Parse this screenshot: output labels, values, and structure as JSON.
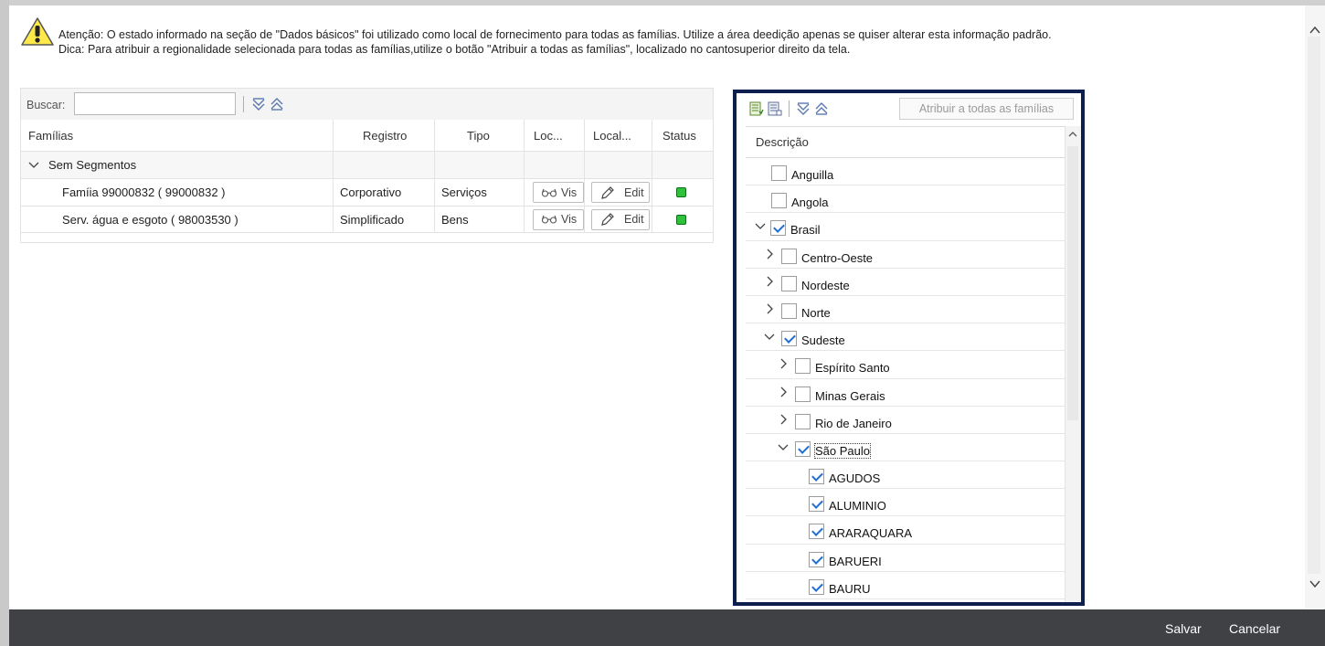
{
  "notice": {
    "line1": "Atenção: O estado informado na seção de \"Dados básicos\" foi utilizado como local de fornecimento para todas as famílias. Utilize a área deedição apenas se quiser alterar esta informação padrão.",
    "line2": "Dica: Para atribuir a regionalidade selecionada para todas as famílias,utilize o botão \"Atribuir a todas as famílias\", localizado no cantosuperior direito da tela."
  },
  "search": {
    "label": "Buscar:",
    "value": ""
  },
  "families_table": {
    "columns": [
      "Famílias",
      "Registro",
      "Tipo",
      "Loc...",
      "Local...",
      "Status"
    ],
    "group": "Sem Segmentos",
    "rows": [
      {
        "familia": "Famíia 99000832 ( 99000832 )",
        "registro": "Corporativo",
        "tipo": "Serviços",
        "view_label": "Vis",
        "edit_label": "Edit"
      },
      {
        "familia": "Serv. água e esgoto ( 98003530 )",
        "registro": "Simplificado",
        "tipo": "Bens",
        "view_label": "Vis",
        "edit_label": "Edit"
      }
    ],
    "status_color": "#2ec23a"
  },
  "region_tree": {
    "assign_button": "Atribuir a todas as famílias",
    "header": "Descrição",
    "nodes": [
      {
        "label": "Anguilla",
        "checked": false,
        "expandable": false,
        "expanded": false,
        "level": 0
      },
      {
        "label": "Angola",
        "checked": false,
        "expandable": false,
        "expanded": false,
        "level": 0
      },
      {
        "label": "Brasil",
        "checked": true,
        "expandable": true,
        "expanded": true,
        "level": 0
      },
      {
        "label": "Centro-Oeste",
        "checked": false,
        "expandable": true,
        "expanded": false,
        "level": 1
      },
      {
        "label": "Nordeste",
        "checked": false,
        "expandable": true,
        "expanded": false,
        "level": 1
      },
      {
        "label": "Norte",
        "checked": false,
        "expandable": true,
        "expanded": false,
        "level": 1
      },
      {
        "label": "Sudeste",
        "checked": true,
        "expandable": true,
        "expanded": true,
        "level": 1
      },
      {
        "label": "Espírito Santo",
        "checked": false,
        "expandable": true,
        "expanded": false,
        "level": 2
      },
      {
        "label": "Minas Gerais",
        "checked": false,
        "expandable": true,
        "expanded": false,
        "level": 2
      },
      {
        "label": "Rio de Janeiro",
        "checked": false,
        "expandable": true,
        "expanded": false,
        "level": 2
      },
      {
        "label": "São Paulo",
        "checked": true,
        "expandable": true,
        "expanded": true,
        "level": 2,
        "focused": true
      },
      {
        "label": "AGUDOS",
        "checked": true,
        "expandable": false,
        "expanded": false,
        "level": 3
      },
      {
        "label": "ALUMINIO",
        "checked": true,
        "expandable": false,
        "expanded": false,
        "level": 3
      },
      {
        "label": "ARARAQUARA",
        "checked": true,
        "expandable": false,
        "expanded": false,
        "level": 3
      },
      {
        "label": "BARUERI",
        "checked": true,
        "expandable": false,
        "expanded": false,
        "level": 3
      },
      {
        "label": "BAURU",
        "checked": true,
        "expandable": false,
        "expanded": false,
        "level": 3
      }
    ]
  },
  "footer": {
    "save": "Salvar",
    "cancel": "Cancelar"
  },
  "colors": {
    "footer_bg": "#3f4144",
    "highlight_border": "#0d1f4d",
    "check": "#1f6fd1"
  }
}
